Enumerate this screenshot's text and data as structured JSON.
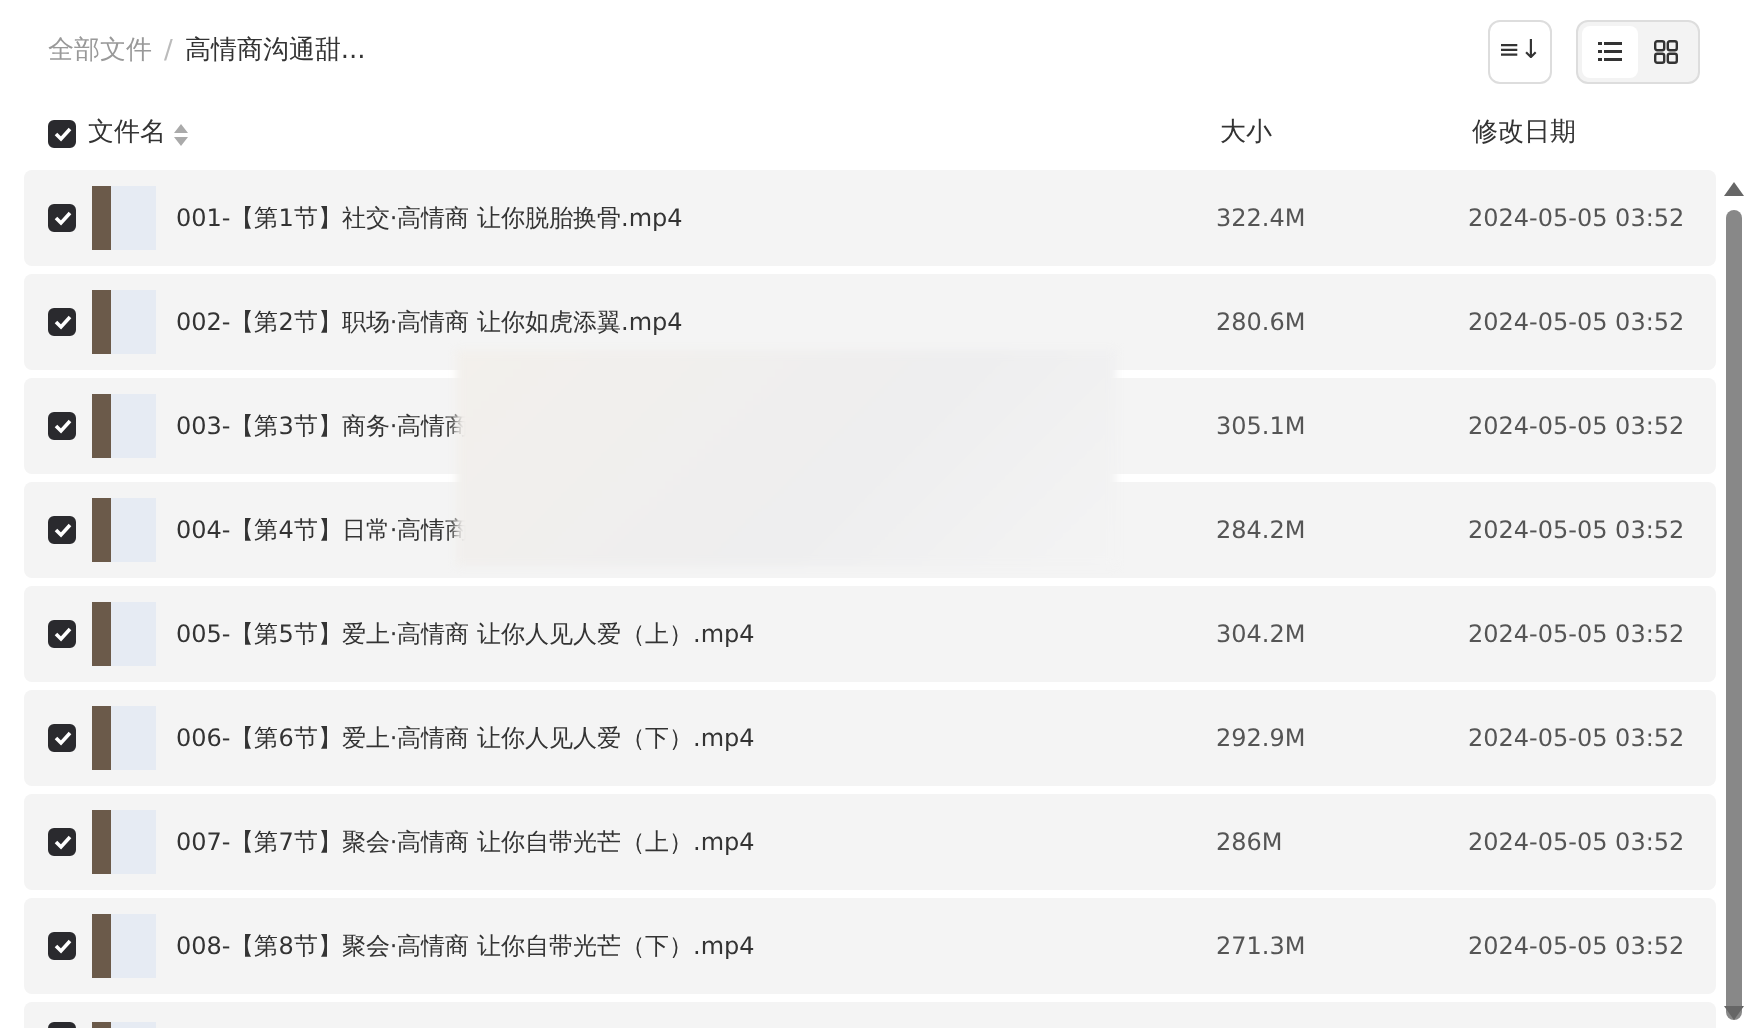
{
  "breadcrumb_separator": "/",
  "breadcrumb": [
    {
      "label": "全部文件",
      "current": false
    },
    {
      "label": "高情商沟通甜...",
      "current": true
    }
  ],
  "toolbar": {
    "sort_button": "≡↓",
    "views": [
      {
        "kind": "list",
        "selected": true
      },
      {
        "kind": "grid",
        "selected": false
      }
    ]
  },
  "table": {
    "select_all": {
      "checked": true
    },
    "columns": [
      "文件名",
      "大小",
      "修改日期"
    ],
    "rows": [
      {
        "checked": true,
        "name": "001-【第1节】社交·高情商 让你脱胎换骨.mp4",
        "size": "322.4M",
        "date": "2024-05-05 03:52"
      },
      {
        "checked": true,
        "name": "002-【第2节】职场·高情商 让你如虎添翼.mp4",
        "size": "280.6M",
        "date": "2024-05-05 03:52"
      },
      {
        "checked": true,
        "name": "003-【第3节】商务·高情商",
        "size": "305.1M",
        "date": "2024-05-05 03:52"
      },
      {
        "checked": true,
        "name": "004-【第4节】日常·高情商",
        "size": "284.2M",
        "date": "2024-05-05 03:52"
      },
      {
        "checked": true,
        "name": "005-【第5节】爱上·高情商 让你人见人爱（上）.mp4",
        "size": "304.2M",
        "date": "2024-05-05 03:52"
      },
      {
        "checked": true,
        "name": "006-【第6节】爱上·高情商 让你人见人爱（下）.mp4",
        "size": "292.9M",
        "date": "2024-05-05 03:52"
      },
      {
        "checked": true,
        "name": "007-【第7节】聚会·高情商 让你自带光芒（上）.mp4",
        "size": "286M",
        "date": "2024-05-05 03:52"
      },
      {
        "checked": true,
        "name": "008-【第8节】聚会·高情商 让你自带光芒（下）.mp4",
        "size": "271.3M",
        "date": "2024-05-05 03:52"
      },
      {
        "checked": true
      }
    ]
  }
}
